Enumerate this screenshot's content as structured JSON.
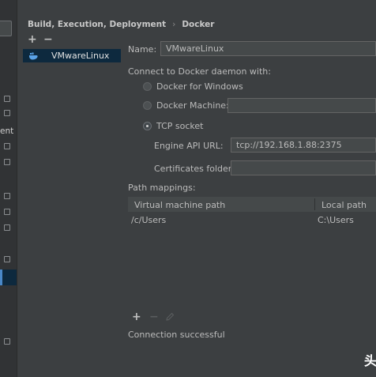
{
  "breadcrumb": {
    "parent": "Build, Execution, Deployment",
    "separator": "›",
    "current": "Docker"
  },
  "sidebar": {
    "fragment_label": "ent"
  },
  "server_list": {
    "add_symbol": "+",
    "remove_symbol": "−",
    "items": [
      {
        "label": "VMwareLinux",
        "selected": true,
        "icon": "docker-whale-icon"
      }
    ]
  },
  "form": {
    "name_label": "Name:",
    "name_value": "VMwareLinux",
    "connect_heading": "Connect to Docker daemon with:",
    "options": [
      {
        "label": "Docker for Windows",
        "selected": false
      },
      {
        "label": "Docker Machine:",
        "selected": false,
        "value": ""
      },
      {
        "label": "TCP socket",
        "selected": true
      }
    ],
    "engine_api_label": "Engine API URL:",
    "engine_api_value": "tcp://192.168.1.88:2375",
    "certificates_label": "Certificates folder:",
    "certificates_value": ""
  },
  "path_mappings": {
    "heading": "Path mappings:",
    "columns": [
      "Virtual machine path",
      "Local path"
    ],
    "rows": [
      {
        "vm_path": "/c/Users",
        "local_path": "C:\\Users"
      }
    ],
    "add_symbol": "+",
    "remove_symbol": "−",
    "edit_icon": "pencil-icon"
  },
  "status": {
    "message": "Connection successful"
  },
  "watermark": "头",
  "colors": {
    "background": "#3c3f41",
    "selection": "#0d293e",
    "field": "#45494a",
    "accent": "#4a88c7"
  }
}
